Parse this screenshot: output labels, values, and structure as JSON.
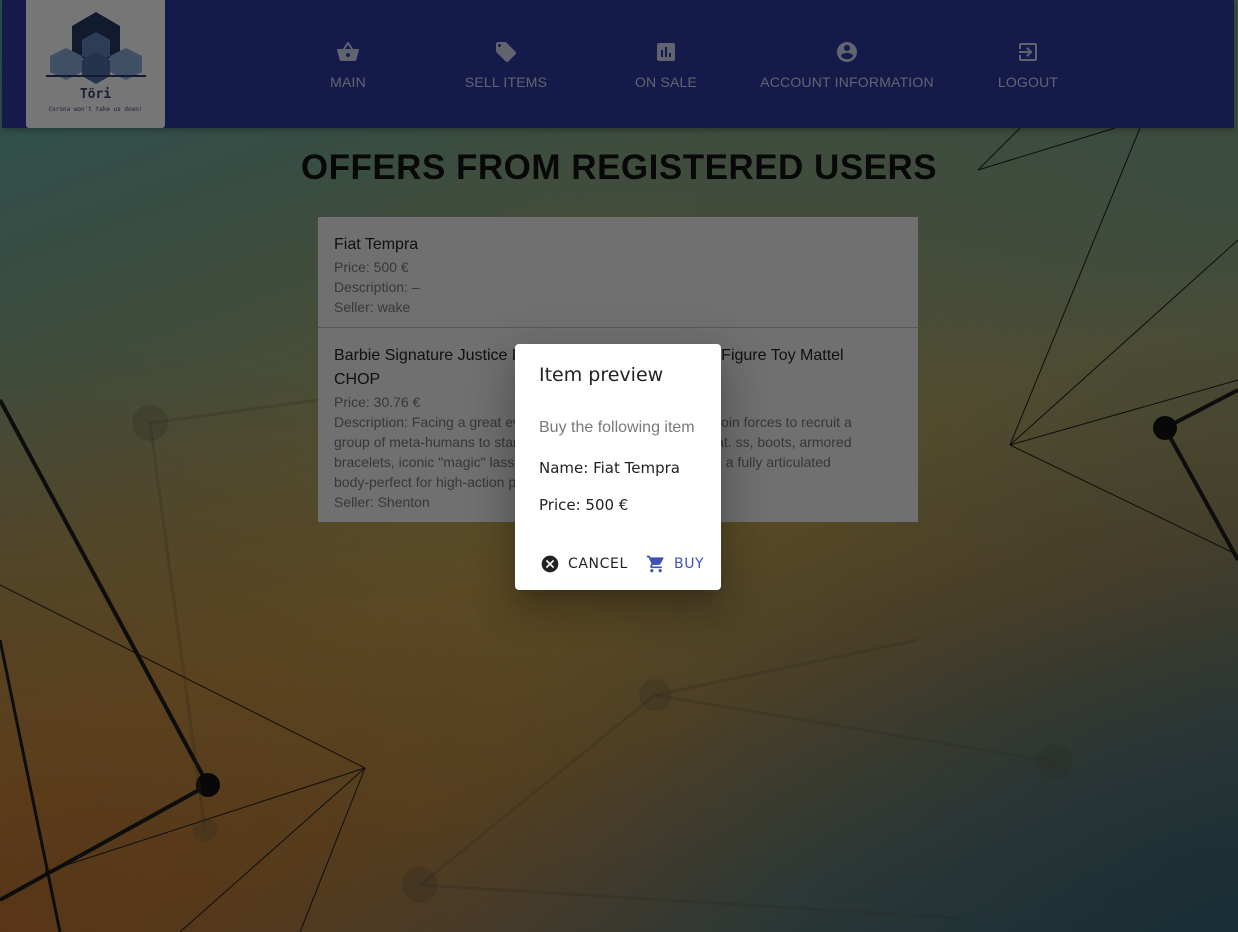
{
  "brand": {
    "name": "Töri",
    "tagline": "Corona won't take us down!"
  },
  "nav": {
    "items": [
      {
        "label": "MAIN",
        "icon": "basket-icon"
      },
      {
        "label": "SELL ITEMS",
        "icon": "tag-icon"
      },
      {
        "label": "ON SALE",
        "icon": "chart-icon"
      },
      {
        "label": "ACCOUNT INFORMATION",
        "icon": "account-icon"
      },
      {
        "label": "LOGOUT",
        "icon": "logout-icon"
      }
    ]
  },
  "page": {
    "title": "OFFERS FROM REGISTERED USERS"
  },
  "offers": [
    {
      "title": "Fiat Tempra",
      "price": "Price: 500 €",
      "description": "Description: –",
      "seller": "Seller: wake"
    },
    {
      "title_line1": "Barbie Signature Justice League Wonder Woman Doll Figure Toy Mattel",
      "title_line2": "CHOP",
      "price": "Price: 30.76 €",
      "desc_line1": "Description: Facing a great evil, Batman and Wonder Woman join forces to recruit a",
      "desc_line2": "group of meta-humans to stand together against this new threat. ss, boots, armored",
      "desc_line3": "bracelets, iconic \"magic\" lasso and tiara. The doll also features a fully articulated",
      "desc_line4": "body-perfect for high-action play.",
      "seller": "Seller: Shenton"
    }
  ],
  "dialog": {
    "title": "Item preview",
    "subtitle": "Buy the following item",
    "name": "Name: Fiat Tempra",
    "price": "Price: 500 €",
    "cancel_label": "CANCEL",
    "buy_label": "BUY"
  },
  "colors": {
    "nav_bg": "#283593",
    "accent": "#3f51b5",
    "overlay": "rgba(0,0,0,0.5)"
  }
}
